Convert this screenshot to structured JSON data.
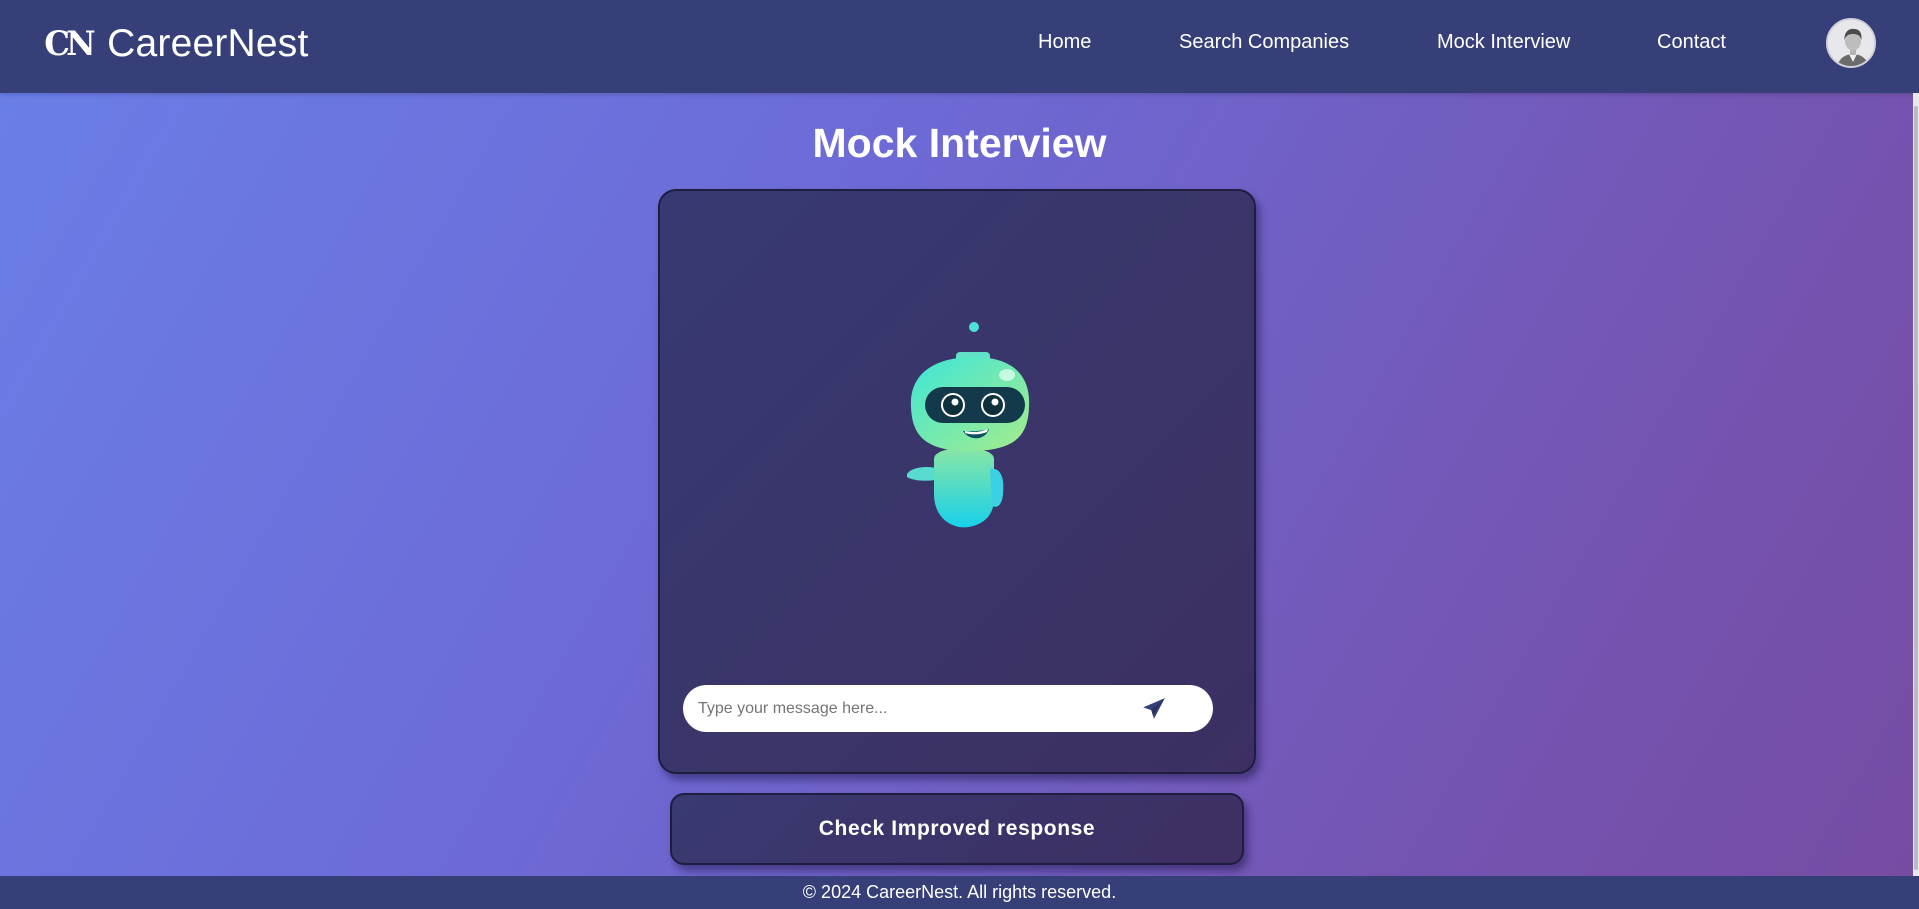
{
  "header": {
    "logo_mark": "CN",
    "brand_name": "CareerNest",
    "nav": [
      {
        "label": "Home"
      },
      {
        "label": "Search Companies"
      },
      {
        "label": "Mock Interview"
      },
      {
        "label": "Contact"
      }
    ],
    "avatar_icon": "user-avatar-icon"
  },
  "main": {
    "title": "Mock Interview",
    "chat": {
      "mascot_icon": "robot-mascot-icon",
      "input_placeholder": "Type your message here...",
      "input_value": "",
      "send_icon": "paper-plane-icon"
    },
    "improve_button_label": "Check Improved response"
  },
  "footer": {
    "text": "© 2024 CareerNest. All rights reserved."
  },
  "colors": {
    "header_bg": "#363f78",
    "card_bg": "#3a3568",
    "background_start": "#6a7fe8",
    "background_end": "#764ba2",
    "robot_accent": "#4fe0d6"
  }
}
